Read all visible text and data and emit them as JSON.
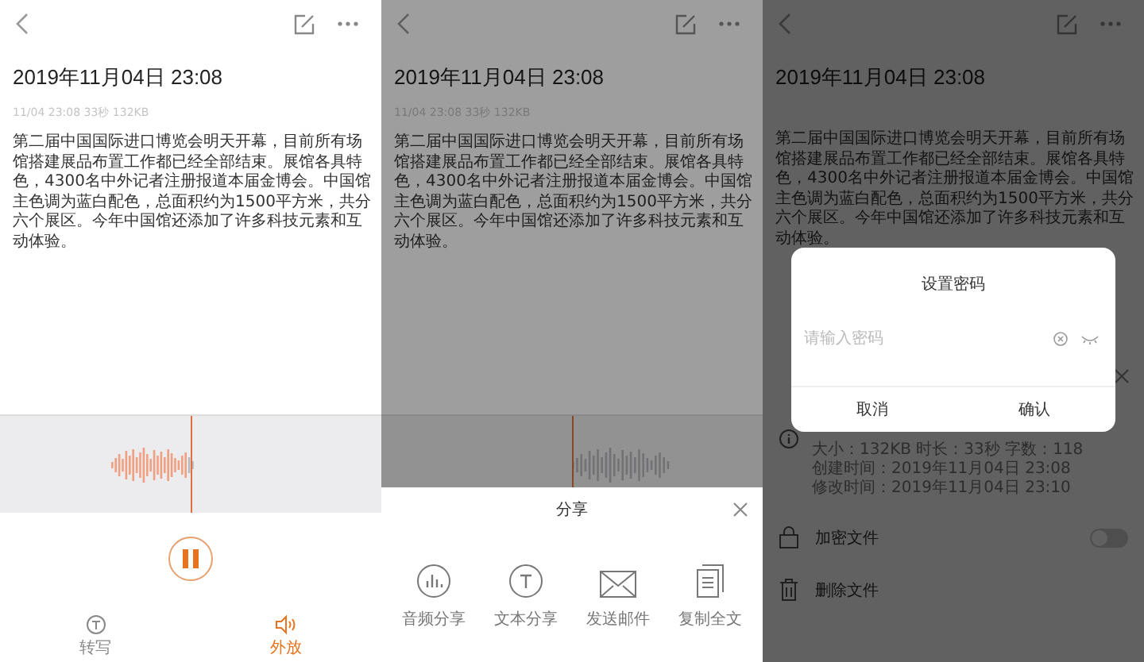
{
  "screens": [
    {
      "kind": "player",
      "note": {
        "title": "2019年11月04日 23:08",
        "meta": "11/04 23:08 33秒 132KB",
        "body": "第二届中国国际进口博览会明天开幕，目前所有场馆搭建展品布置工作都已经全部结束。展馆各具特色，4300名中外记者注册报道本届金博会。中国馆主色调为蓝白配色，总面积约为1500平方米，共分六个展区。今年中国馆还添加了许多科技元素和互动体验。"
      },
      "waveform": {
        "level": 0.5
      },
      "player": {
        "playing": true
      },
      "bottom_bar": [
        {
          "kind": "transcribe",
          "label": "转写",
          "selected": false
        },
        {
          "kind": "speaker",
          "label": "外放",
          "selected": true
        }
      ]
    },
    {
      "kind": "share",
      "note": {
        "title": "2019年11月04日 23:08",
        "meta": "11/04 23:08 33秒 132KB",
        "body": "第二届中国国际进口博览会明天开幕，目前所有场馆搭建展品布置工作都已经全部结束。展馆各具特色，4300名中外记者注册报道本届金博会。中国馆主色调为蓝白配色，总面积约为1500平方米，共分六个展区。今年中国馆还添加了许多科技元素和互动体验。"
      },
      "waveform": {
        "level": 0.5
      },
      "share_sheet": {
        "title": "分享",
        "options": [
          {
            "kind": "audio",
            "label": "音频分享"
          },
          {
            "kind": "text",
            "label": "文本分享"
          },
          {
            "kind": "mail",
            "label": "发送邮件"
          },
          {
            "kind": "copy",
            "label": "复制全文"
          }
        ]
      }
    },
    {
      "kind": "lock",
      "note": {
        "title": "2019年11月04日 23:08",
        "body": "第二届中国国际进口博览会明天开幕，目前所有场馆搭建展品布置工作都已经全部结束。展馆各具特色，4300名中外记者注册报道本届金博会。中国馆主色调为蓝白配色，总面积约为1500平方米，共分六个展区。今年中国馆还添加了许多科技元素和互动体验。"
      },
      "file_sheet": {
        "info_lines": [
          "大小：132KB  时长：33秒  字数：118",
          "创建时间：2019年11月04日 23:08",
          "修改时间：2019年11月04日 23:10"
        ],
        "rows": [
          {
            "kind": "lock",
            "label": "加密文件",
            "on": false
          },
          {
            "kind": "delete",
            "label": "删除文件"
          }
        ]
      },
      "dialog": {
        "title": "设置密码",
        "placeholder": "请输入密码",
        "buttons": [
          "取消",
          "确认"
        ]
      }
    }
  ]
}
